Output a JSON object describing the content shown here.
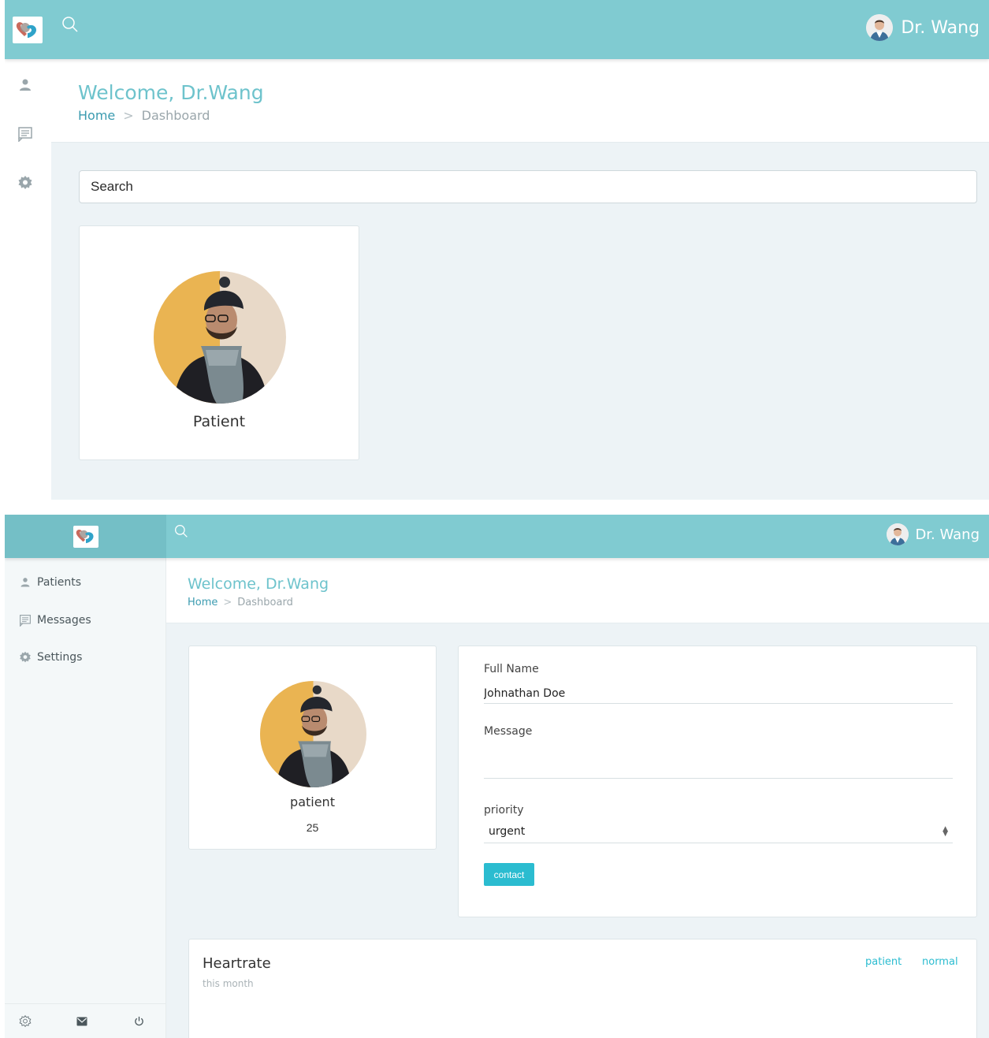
{
  "header": {
    "user_name": "Dr. Wang"
  },
  "page": {
    "title": "Welcome, Dr.Wang",
    "breadcrumb": {
      "home": "Home",
      "separator": ">",
      "current": "Dashboard"
    }
  },
  "screen_a": {
    "search_placeholder": "Search",
    "patient_card_label": "Patient"
  },
  "screen_b": {
    "sidebar": {
      "items": [
        {
          "label": "Patients",
          "icon": "person-icon"
        },
        {
          "label": "Messages",
          "icon": "message-icon"
        },
        {
          "label": "Settings",
          "icon": "gear-icon"
        }
      ],
      "footer_icons": [
        "settings-outline-icon",
        "mail-icon",
        "power-icon"
      ]
    },
    "patient": {
      "name": "patient",
      "age": "25"
    },
    "form": {
      "full_name_label": "Full Name",
      "full_name_value": "Johnathan Doe",
      "message_label": "Message",
      "message_value": "",
      "priority_label": "priority",
      "priority_value": "urgent",
      "submit_label": "contact"
    },
    "chart": {
      "title": "Heartrate",
      "subtitle": "this month",
      "legend": [
        "patient",
        "normal"
      ]
    }
  },
  "colors": {
    "topbar": "#80cbd1",
    "accent": "#2bbcd0",
    "title_teal": "#6ec3cc",
    "background": "#edf3f6"
  }
}
